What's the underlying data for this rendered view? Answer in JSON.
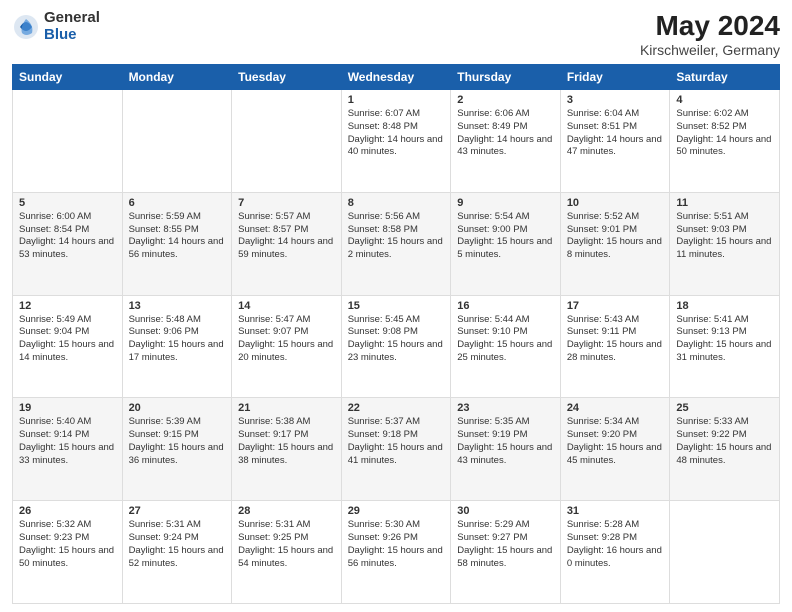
{
  "logo": {
    "general": "General",
    "blue": "Blue"
  },
  "title": "May 2024",
  "location": "Kirschweiler, Germany",
  "days_of_week": [
    "Sunday",
    "Monday",
    "Tuesday",
    "Wednesday",
    "Thursday",
    "Friday",
    "Saturday"
  ],
  "weeks": [
    [
      {
        "day": "",
        "details": ""
      },
      {
        "day": "",
        "details": ""
      },
      {
        "day": "",
        "details": ""
      },
      {
        "day": "1",
        "details": "Sunrise: 6:07 AM\nSunset: 8:48 PM\nDaylight: 14 hours\nand 40 minutes."
      },
      {
        "day": "2",
        "details": "Sunrise: 6:06 AM\nSunset: 8:49 PM\nDaylight: 14 hours\nand 43 minutes."
      },
      {
        "day": "3",
        "details": "Sunrise: 6:04 AM\nSunset: 8:51 PM\nDaylight: 14 hours\nand 47 minutes."
      },
      {
        "day": "4",
        "details": "Sunrise: 6:02 AM\nSunset: 8:52 PM\nDaylight: 14 hours\nand 50 minutes."
      }
    ],
    [
      {
        "day": "5",
        "details": "Sunrise: 6:00 AM\nSunset: 8:54 PM\nDaylight: 14 hours\nand 53 minutes."
      },
      {
        "day": "6",
        "details": "Sunrise: 5:59 AM\nSunset: 8:55 PM\nDaylight: 14 hours\nand 56 minutes."
      },
      {
        "day": "7",
        "details": "Sunrise: 5:57 AM\nSunset: 8:57 PM\nDaylight: 14 hours\nand 59 minutes."
      },
      {
        "day": "8",
        "details": "Sunrise: 5:56 AM\nSunset: 8:58 PM\nDaylight: 15 hours\nand 2 minutes."
      },
      {
        "day": "9",
        "details": "Sunrise: 5:54 AM\nSunset: 9:00 PM\nDaylight: 15 hours\nand 5 minutes."
      },
      {
        "day": "10",
        "details": "Sunrise: 5:52 AM\nSunset: 9:01 PM\nDaylight: 15 hours\nand 8 minutes."
      },
      {
        "day": "11",
        "details": "Sunrise: 5:51 AM\nSunset: 9:03 PM\nDaylight: 15 hours\nand 11 minutes."
      }
    ],
    [
      {
        "day": "12",
        "details": "Sunrise: 5:49 AM\nSunset: 9:04 PM\nDaylight: 15 hours\nand 14 minutes."
      },
      {
        "day": "13",
        "details": "Sunrise: 5:48 AM\nSunset: 9:06 PM\nDaylight: 15 hours\nand 17 minutes."
      },
      {
        "day": "14",
        "details": "Sunrise: 5:47 AM\nSunset: 9:07 PM\nDaylight: 15 hours\nand 20 minutes."
      },
      {
        "day": "15",
        "details": "Sunrise: 5:45 AM\nSunset: 9:08 PM\nDaylight: 15 hours\nand 23 minutes."
      },
      {
        "day": "16",
        "details": "Sunrise: 5:44 AM\nSunset: 9:10 PM\nDaylight: 15 hours\nand 25 minutes."
      },
      {
        "day": "17",
        "details": "Sunrise: 5:43 AM\nSunset: 9:11 PM\nDaylight: 15 hours\nand 28 minutes."
      },
      {
        "day": "18",
        "details": "Sunrise: 5:41 AM\nSunset: 9:13 PM\nDaylight: 15 hours\nand 31 minutes."
      }
    ],
    [
      {
        "day": "19",
        "details": "Sunrise: 5:40 AM\nSunset: 9:14 PM\nDaylight: 15 hours\nand 33 minutes."
      },
      {
        "day": "20",
        "details": "Sunrise: 5:39 AM\nSunset: 9:15 PM\nDaylight: 15 hours\nand 36 minutes."
      },
      {
        "day": "21",
        "details": "Sunrise: 5:38 AM\nSunset: 9:17 PM\nDaylight: 15 hours\nand 38 minutes."
      },
      {
        "day": "22",
        "details": "Sunrise: 5:37 AM\nSunset: 9:18 PM\nDaylight: 15 hours\nand 41 minutes."
      },
      {
        "day": "23",
        "details": "Sunrise: 5:35 AM\nSunset: 9:19 PM\nDaylight: 15 hours\nand 43 minutes."
      },
      {
        "day": "24",
        "details": "Sunrise: 5:34 AM\nSunset: 9:20 PM\nDaylight: 15 hours\nand 45 minutes."
      },
      {
        "day": "25",
        "details": "Sunrise: 5:33 AM\nSunset: 9:22 PM\nDaylight: 15 hours\nand 48 minutes."
      }
    ],
    [
      {
        "day": "26",
        "details": "Sunrise: 5:32 AM\nSunset: 9:23 PM\nDaylight: 15 hours\nand 50 minutes."
      },
      {
        "day": "27",
        "details": "Sunrise: 5:31 AM\nSunset: 9:24 PM\nDaylight: 15 hours\nand 52 minutes."
      },
      {
        "day": "28",
        "details": "Sunrise: 5:31 AM\nSunset: 9:25 PM\nDaylight: 15 hours\nand 54 minutes."
      },
      {
        "day": "29",
        "details": "Sunrise: 5:30 AM\nSunset: 9:26 PM\nDaylight: 15 hours\nand 56 minutes."
      },
      {
        "day": "30",
        "details": "Sunrise: 5:29 AM\nSunset: 9:27 PM\nDaylight: 15 hours\nand 58 minutes."
      },
      {
        "day": "31",
        "details": "Sunrise: 5:28 AM\nSunset: 9:28 PM\nDaylight: 16 hours\nand 0 minutes."
      },
      {
        "day": "",
        "details": ""
      }
    ]
  ]
}
